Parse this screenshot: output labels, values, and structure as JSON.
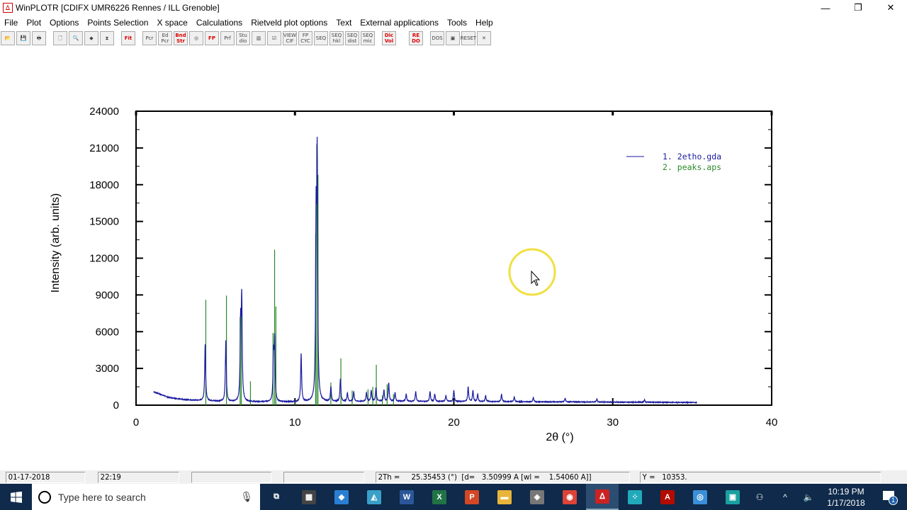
{
  "window": {
    "title": "WinPLOTR [CDIFX UMR6226 Rennes / ILL Grenoble]",
    "minimize": "—",
    "restore": "❐",
    "close": "✕"
  },
  "menu": [
    "File",
    "Plot",
    "Options",
    "Points Selection",
    "X space",
    "Calculations",
    "Rietveld plot options",
    "Text",
    "External applications",
    "Tools",
    "Help"
  ],
  "toolbar": [
    {
      "icon": "open-folder-icon",
      "label": "📂"
    },
    {
      "icon": "save-icon",
      "label": "💾"
    },
    {
      "icon": "print-icon",
      "label": "🖶"
    },
    null,
    {
      "icon": "preview-icon",
      "label": "🗋"
    },
    {
      "icon": "zoom-icon",
      "label": "🔍"
    },
    {
      "icon": "expand-horizontal-icon",
      "label": "◆"
    },
    {
      "icon": "expand-vertical-icon",
      "label": "⧗"
    },
    null,
    {
      "icon": "fit-icon",
      "label": "Fit",
      "red": true
    },
    null,
    {
      "icon": "pcr-icon",
      "label": "Pcr"
    },
    {
      "icon": "edit-pcr-icon",
      "label": "Ed Pcr"
    },
    {
      "icon": "band-structure-icon",
      "label": "Bnd Str",
      "red": true
    },
    {
      "icon": "rings-icon",
      "label": "◎"
    },
    {
      "icon": "fullprof-icon",
      "label": "FP",
      "red": true
    },
    {
      "icon": "prf-icon",
      "label": "Prf"
    },
    {
      "icon": "studio-icon",
      "label": "Stu dio"
    },
    {
      "icon": "book-icon",
      "label": "▥"
    },
    {
      "icon": "check-icon",
      "label": "☑"
    },
    {
      "icon": "view-cif-icon",
      "label": "VIEW CIF"
    },
    {
      "icon": "fp-cyc-icon",
      "label": "FP CYC"
    },
    {
      "icon": "seq-icon",
      "label": "SEQ"
    },
    {
      "icon": "seq-hkl-icon",
      "label": "SEQ hkl"
    },
    {
      "icon": "seq-dist-icon",
      "label": "SEQ dist"
    },
    {
      "icon": "seq-mic-icon",
      "label": "SEQ mic"
    },
    null,
    {
      "icon": "dicvol-icon",
      "label": "Dic Vol",
      "red": true
    },
    null,
    null,
    {
      "icon": "redo-icon",
      "label": "RE DO",
      "red": true
    },
    null,
    {
      "icon": "dos-icon",
      "label": "DOS"
    },
    {
      "icon": "image-icon",
      "label": "▣"
    },
    {
      "icon": "reset-icon",
      "label": "RESET"
    },
    {
      "icon": "close-x-icon",
      "label": "✕"
    }
  ],
  "status": {
    "date": "01-17-2018",
    "time": "22:19",
    "field3": "",
    "field4": "",
    "coords": "2Th =     25.35453 (°)  [d=   3.50999 A [wl =    1.54060 A]]",
    "y": "Y =   10353."
  },
  "taskbar": {
    "search_placeholder": "Type here to search",
    "clock_time": "10:19 PM",
    "clock_date": "1/17/2018",
    "notifications": "1",
    "apps": [
      {
        "name": "task-view",
        "g": "⧉",
        "c": "transparent"
      },
      {
        "name": "calculator",
        "g": "▦",
        "c": "#444"
      },
      {
        "name": "app-blue",
        "g": "◆",
        "c": "#2a7fd4"
      },
      {
        "name": "app-teal",
        "g": "◭",
        "c": "#3aa0c8"
      },
      {
        "name": "word",
        "g": "W",
        "c": "#2b579a"
      },
      {
        "name": "excel",
        "g": "X",
        "c": "#217346"
      },
      {
        "name": "powerpoint",
        "g": "P",
        "c": "#d24726"
      },
      {
        "name": "file-explorer",
        "g": "▬",
        "c": "#e8b53a"
      },
      {
        "name": "vmware",
        "g": "◈",
        "c": "#777"
      },
      {
        "name": "chrome",
        "g": "◉",
        "c": "#db4437"
      },
      {
        "name": "winplotr",
        "g": "ᐃ",
        "c": "#c22",
        "active": true
      },
      {
        "name": "app-dots",
        "g": "⁘",
        "c": "#2ab"
      },
      {
        "name": "acrobat",
        "g": "A",
        "c": "#b30b00"
      },
      {
        "name": "app-circle",
        "g": "◎",
        "c": "#3a8fd8"
      },
      {
        "name": "app-cube",
        "g": "▣",
        "c": "#19a0a0"
      }
    ]
  },
  "chart_data": {
    "type": "line",
    "xlabel": "2θ (°)",
    "ylabel": "Intensity (arb. units)",
    "xlim": [
      0,
      40
    ],
    "ylim": [
      0,
      24000
    ],
    "xticks": [
      0,
      10,
      20,
      30,
      40
    ],
    "yticks": [
      0,
      3000,
      6000,
      9000,
      12000,
      15000,
      18000,
      21000,
      24000
    ],
    "legend": {
      "placement": "top-right",
      "entries": [
        "1. 2etho.gda",
        "2. peaks.aps"
      ]
    },
    "colors": {
      "observed": "#1a1aa0",
      "calculated": "#2a8a2a"
    },
    "observed": {
      "range": [
        1.1,
        35.3
      ],
      "background": [
        [
          1.1,
          1100
        ],
        [
          2,
          650
        ],
        [
          3,
          450
        ],
        [
          4,
          380
        ],
        [
          6,
          280
        ],
        [
          10,
          260
        ],
        [
          15,
          320
        ],
        [
          20,
          300
        ],
        [
          30,
          250
        ],
        [
          35.3,
          220
        ]
      ],
      "peaks": [
        [
          4.35,
          4600
        ],
        [
          5.65,
          5000
        ],
        [
          6.58,
          6000
        ],
        [
          6.65,
          8000
        ],
        [
          8.65,
          3600
        ],
        [
          8.72,
          4900
        ],
        [
          10.39,
          3900
        ],
        [
          11.33,
          13800
        ],
        [
          11.4,
          18850
        ],
        [
          12.26,
          1200
        ],
        [
          12.86,
          1850
        ],
        [
          13.3,
          700
        ],
        [
          13.7,
          800
        ],
        [
          14.5,
          700
        ],
        [
          14.8,
          900
        ],
        [
          15.1,
          1100
        ],
        [
          15.6,
          900
        ],
        [
          15.9,
          1500
        ],
        [
          16.3,
          700
        ],
        [
          17.0,
          600
        ],
        [
          17.6,
          800
        ],
        [
          18.5,
          800
        ],
        [
          18.8,
          600
        ],
        [
          19.5,
          500
        ],
        [
          20.0,
          900
        ],
        [
          20.9,
          1200
        ],
        [
          21.2,
          900
        ],
        [
          21.5,
          600
        ],
        [
          22.0,
          500
        ],
        [
          23.0,
          600
        ],
        [
          23.8,
          400
        ],
        [
          25.0,
          350
        ],
        [
          27.0,
          300
        ],
        [
          29.0,
          250
        ],
        [
          32.0,
          200
        ]
      ]
    },
    "calculated": {
      "peaks": [
        [
          4.39,
          8600
        ],
        [
          5.69,
          8950
        ],
        [
          6.55,
          7200
        ],
        [
          6.62,
          8000
        ],
        [
          7.2,
          1950
        ],
        [
          8.62,
          5900
        ],
        [
          8.72,
          12700
        ],
        [
          8.8,
          8050
        ],
        [
          10.0,
          300
        ],
        [
          11.3,
          14000
        ],
        [
          11.37,
          21300
        ],
        [
          11.45,
          18800
        ],
        [
          12.26,
          1850
        ],
        [
          12.89,
          3820
        ],
        [
          13.6,
          1200
        ],
        [
          14.6,
          1300
        ],
        [
          14.9,
          1500
        ],
        [
          15.12,
          3300
        ],
        [
          15.5,
          800
        ],
        [
          15.8,
          1700
        ],
        [
          16.2,
          900
        ]
      ]
    }
  }
}
